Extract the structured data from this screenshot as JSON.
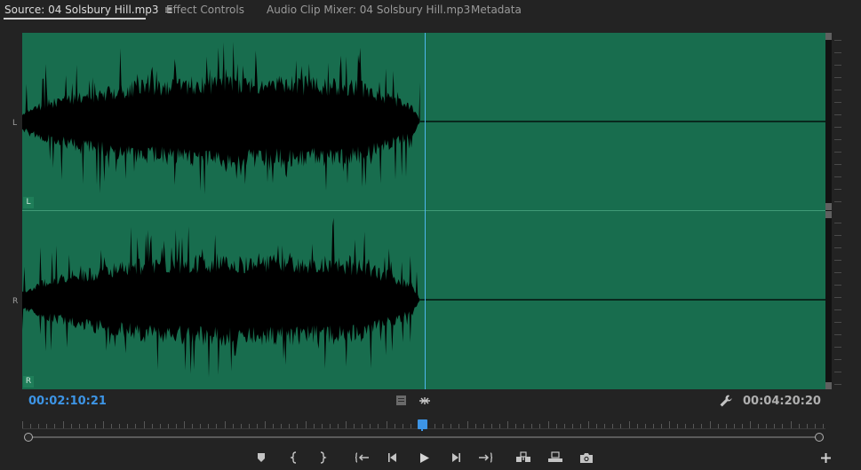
{
  "tabs": [
    {
      "label": "Source: 04 Solsbury Hill.mp3",
      "active": true
    },
    {
      "label": "Effect Controls",
      "active": false
    },
    {
      "label": "Audio Clip Mixer: 04 Solsbury Hill.mp3",
      "active": false
    },
    {
      "label": "Metadata",
      "active": false
    }
  ],
  "tab_menu_icon": "hamburger-menu-icon",
  "channels": {
    "left_label": "L",
    "right_label": "R",
    "left_badge": "L",
    "right_badge": "R"
  },
  "timecode": {
    "current": "00:02:10:21",
    "duration": "00:04:20:20"
  },
  "colors": {
    "waveform_bg": "#186d4e",
    "waveform_fill": "#000000",
    "playhead": "#4fb8ee",
    "accent": "#3d95e6"
  },
  "playback_progress": 0.5,
  "transport_icons": [
    "add-marker-icon",
    "mark-in-icon",
    "mark-out-icon",
    "go-to-in-icon",
    "step-back-icon",
    "play-icon",
    "step-forward-icon",
    "go-to-out-icon",
    "insert-icon",
    "overwrite-icon",
    "export-frame-icon"
  ]
}
